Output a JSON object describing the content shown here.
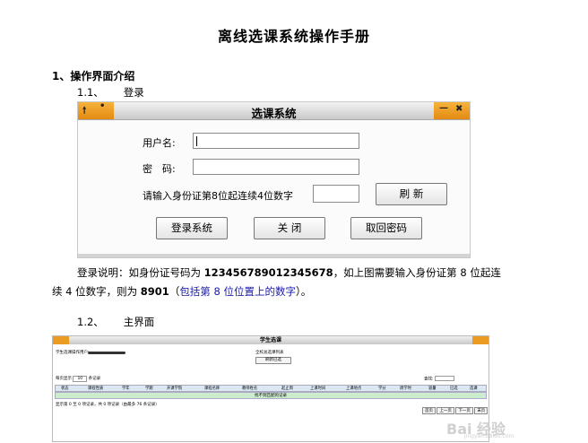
{
  "doc": {
    "title": "离线选课系统操作手册",
    "section1": "1、操作界面介绍",
    "sub1_num": "1.1、",
    "sub1_title": "登录",
    "sub2_num": "1.2、",
    "sub2_title": "主界面"
  },
  "login_window": {
    "title": "选课系统",
    "username_label": "用户名:",
    "password_label": "密　码:",
    "username_value": "",
    "password_value": "",
    "captcha_label": "请输入身份证第8位起连续4位数字",
    "captcha_value": "",
    "refresh_button": "刷 新",
    "login_button": "登录系统",
    "close_button": "关 闭",
    "recover_button": "取回密码",
    "icons": {
      "left": "arrow-up-icon",
      "right_min": "minimize-icon",
      "right_close": "close-icon"
    },
    "accent_color": "#e99b22"
  },
  "explanation": {
    "p1": "登录说明：如身份证号码为 ",
    "id_number": "123456789012345678",
    "p2": "，如上图需要输入身份证第 8 位起连",
    "p3": "续 4 位数字，则为 ",
    "answer": "8901",
    "p4": "（",
    "note": "包括第 8 位位置上的数字",
    "p5": "）。"
  },
  "main_window": {
    "title": "学生选课",
    "student_label": "学生选课操作用户:",
    "list_title": "全校总选课列表",
    "refresh_selected": "刷新已选",
    "per_page_label": "每页显示",
    "per_page_value": "10",
    "per_page_unit": "条记录",
    "search_label": "查找:",
    "columns": [
      "状态",
      "课程性质",
      "学年",
      "学期",
      "开课学院",
      "课程名称",
      "教师姓名",
      "起止周",
      "上课时间",
      "上课地点",
      "学分",
      "周学时",
      "容量",
      "已选",
      "选课"
    ],
    "empty_message": "找不到匹配的记录",
    "footer_info": "显示第 0 至 0 项记录，共 0 项记录（由最多 76 条记录）",
    "pager": [
      "首页",
      "上一页",
      "下一页",
      "末页"
    ]
  },
  "watermark": {
    "text": "Bai 经验",
    "url": "jingyan.baidu.com"
  }
}
